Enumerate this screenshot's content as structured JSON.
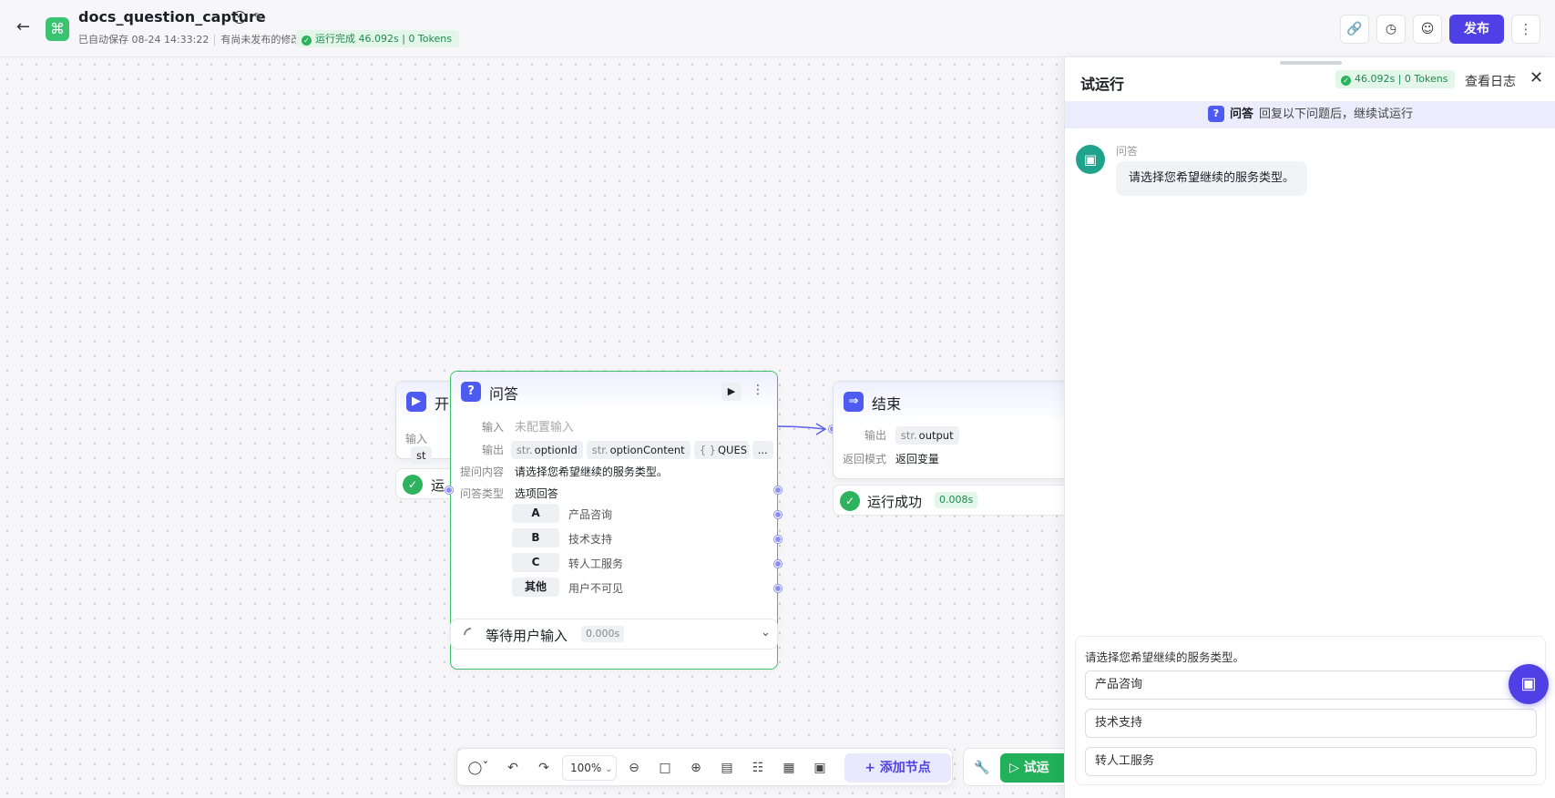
{
  "header": {
    "app_name": "docs_question_capture",
    "autosave": "已自动保存 08-24 14:33:22",
    "unpublished": "有尚未发布的修改",
    "run_status": "运行完成 46.092s | 0 Tokens",
    "publish_label": "发布"
  },
  "canvas": {
    "start_node": {
      "title": "开",
      "input_label": "输入",
      "input_tag": "st",
      "status": "运"
    },
    "qa_node": {
      "title": "问答",
      "input_label": "输入",
      "input_value": "未配置输入",
      "output_label": "输出",
      "outputs": [
        {
          "type": "str.",
          "name": "optionId"
        },
        {
          "type": "str.",
          "name": "optionContent"
        },
        {
          "type": "{ }",
          "name": "QUES"
        }
      ],
      "outputs_more": "...",
      "question_label": "提问内容",
      "question_value": "请选择您希望继续的服务类型。",
      "qtype_label": "问答类型",
      "qtype_value": "选项回答",
      "options": [
        {
          "key": "A",
          "text": "产品咨询"
        },
        {
          "key": "B",
          "text": "技术支持"
        },
        {
          "key": "C",
          "text": "转人工服务"
        },
        {
          "key": "其他",
          "text": "用户不可见"
        }
      ],
      "status": "等待用户输入",
      "status_time": "0.000s"
    },
    "end_node": {
      "title": "结束",
      "output_label": "输出",
      "output_type": "str.",
      "output_name": "output",
      "return_label": "返回模式",
      "return_value": "返回变量",
      "status": "运行成功",
      "status_time": "0.008s"
    }
  },
  "toolbar": {
    "zoom": "100%",
    "add_node": "添加节点",
    "try_run": "试运"
  },
  "panel": {
    "title": "试运行",
    "badge": "46.092s | 0 Tokens",
    "view_log": "查看日志",
    "notice_tag": "问答",
    "notice_text": "回复以下问题后，继续试运行",
    "sender": "问答",
    "message": "请选择您希望继续的服务类型。",
    "answer_prompt": "请选择您希望继续的服务类型。",
    "answer_options": [
      "产品咨询",
      "技术支持",
      "转人工服务"
    ]
  }
}
